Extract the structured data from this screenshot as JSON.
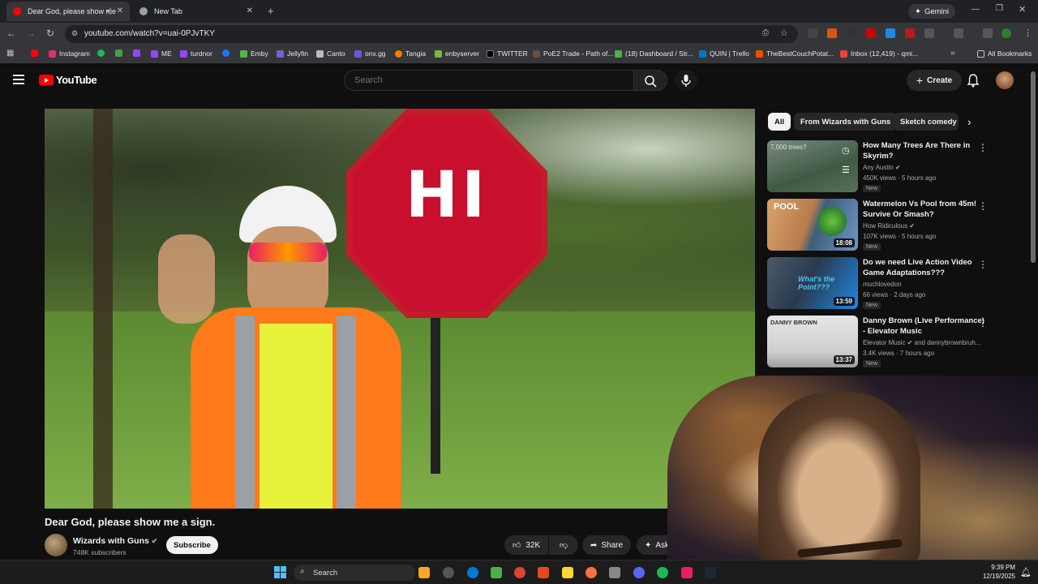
{
  "browser": {
    "tabs": [
      {
        "title": "Dear God, please show me",
        "active": true
      },
      {
        "title": "New Tab",
        "active": false
      }
    ],
    "url": "youtube.com/watch?v=uai-0PJvTKY",
    "gemini_label": "Gemini",
    "bookmarks": [
      "Instagram",
      "ME",
      "turdnor",
      "Emby",
      "Jellyfin",
      "Canto",
      "onx.gg",
      "Tangia",
      "enbyserver",
      "TWITTER",
      "PoE2 Trade - Path of...",
      "(18) Dashboard / Str...",
      "QUIN | Trello",
      "TheBestCouchPotat...",
      "Inbox (12,419) - qmi..."
    ],
    "all_bookmarks_label": "All Bookmarks"
  },
  "youtube": {
    "logo_text": "YouTube",
    "search_placeholder": "Search",
    "create_label": "Create",
    "chips": [
      "All",
      "From Wizards with Guns",
      "Sketch comedy"
    ],
    "video": {
      "sign_text": "HI",
      "title": "Dear God, please show me a sign.",
      "channel": "Wizards with Guns",
      "subscribers": "748K subscribers",
      "subscribe_label": "Subscribe",
      "likes": "32K",
      "share_label": "Share",
      "ask_label": "Ask"
    },
    "recommendations": [
      {
        "title": "How Many Trees Are There in Skyrim?",
        "channel": "Any Austin",
        "meta": "450K views · 5 hours ago",
        "badge": "New",
        "thumb_text": "7,000 trees?",
        "duration": ""
      },
      {
        "title": "Watermelon Vs Pool from 45m! Survive Or Smash?",
        "channel": "How Ridiculous",
        "meta": "107K views · 5 hours ago",
        "badge": "New",
        "thumb_text": "POOL",
        "duration": "18:08"
      },
      {
        "title": "Do we need Live Action Video Game Adaptations???",
        "channel": "muchlovedon",
        "meta": "66 views · 2 days ago",
        "badge": "New",
        "thumb_text": "What's the Point???",
        "duration": "13:59"
      },
      {
        "title": "Danny Brown (Live Performance) - Elevator Music",
        "channel": "Elevator Music",
        "channel_extra": "and dannybrownbruh...",
        "meta": "3.4K views · 7 hours ago",
        "badge": "New",
        "thumb_text": "DANNY BROWN",
        "duration": "13:37"
      }
    ]
  },
  "taskbar": {
    "search_label": "Search",
    "time": "9:39 PM",
    "date": "12/19/2025"
  },
  "colors": {
    "yt_red": "#ff0000",
    "bg": "#0f0f0f",
    "chip_bg": "#272727"
  }
}
